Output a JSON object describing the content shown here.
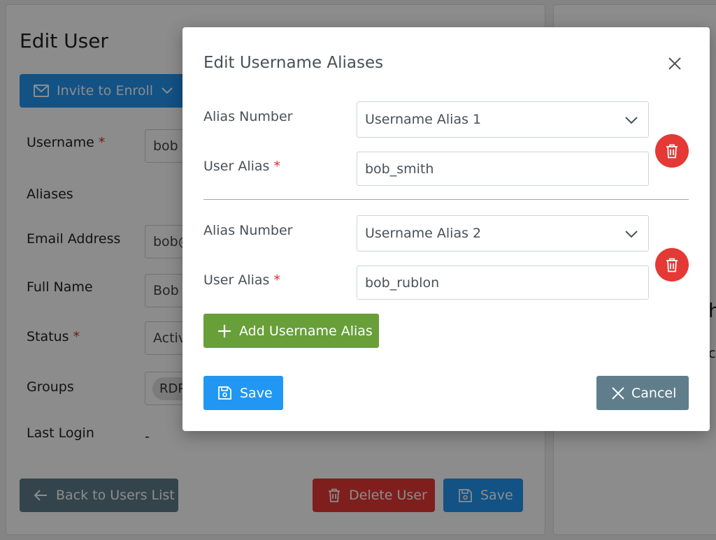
{
  "background": {
    "page_title": "Edit User",
    "invite_button": "Invite to Enroll",
    "fields": {
      "username": {
        "label": "Username",
        "value": "bob"
      },
      "aliases": {
        "label": "Aliases"
      },
      "email": {
        "label": "Email Address",
        "value": "bob@"
      },
      "full_name": {
        "label": "Full Name",
        "value": "Bob S"
      },
      "status": {
        "label": "Status",
        "value": "Activ"
      },
      "groups": {
        "label": "Groups",
        "value": "RDP"
      },
      "last_login": {
        "label": "Last Login",
        "value": "-"
      }
    },
    "required_mark": "*",
    "back_button": "Back to Users List",
    "delete_button": "Delete User",
    "save_button": "Save",
    "right_fragment_1": "h",
    "right_fragment_2": "ca"
  },
  "modal": {
    "title": "Edit Username Aliases",
    "required_mark": "*",
    "aliases": [
      {
        "number_label": "Alias Number",
        "number_value": "Username Alias 1",
        "alias_label": "User Alias",
        "alias_value": "bob_smith"
      },
      {
        "number_label": "Alias Number",
        "number_value": "Username Alias 2",
        "alias_label": "User Alias",
        "alias_value": "bob_rublon"
      }
    ],
    "add_button": "Add Username Alias",
    "save_button": "Save",
    "cancel_button": "Cancel"
  },
  "colors": {
    "primary": "#2196f3",
    "danger": "#e53935",
    "success": "#689f38",
    "secondary": "#607d8b"
  }
}
